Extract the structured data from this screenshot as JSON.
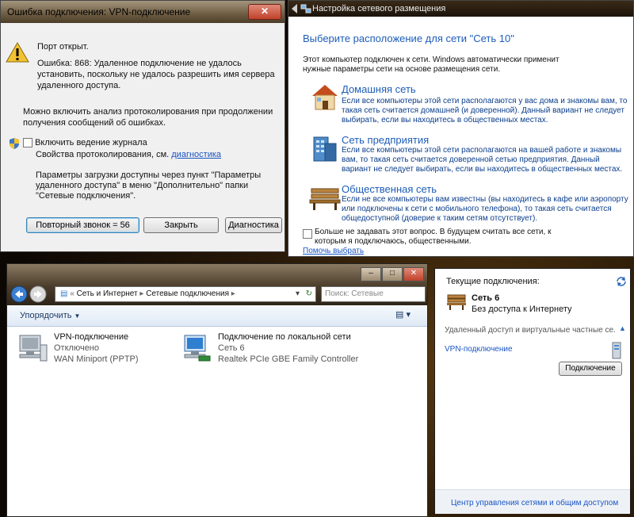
{
  "error_dialog": {
    "title": "Ошибка подключения: VPN-подключение",
    "port_text": "Порт открыт.",
    "error_text": "Ошибка: 868: Удаленное подключение не удалось установить, поскольку не удалось разрешить имя сервера удаленного доступа.",
    "logging_text": "Можно включить анализ протоколирования при продолжении получения сообщений об ошибках.",
    "enable_log_label": "Включить ведение журнала",
    "log_props_text": "Свойства протоколирования, см.",
    "diagnostics_link": "диагностика",
    "params_text": "Параметры загрузки доступны через пункт \"Параметры удаленного доступа\" в меню \"Дополнительно\" папки \"Сетевые подключения\".",
    "redial_button": "Повторный звонок = 56",
    "close_button": "Закрыть",
    "diagnose_button": "Диагностика"
  },
  "location_window": {
    "title": "Настройка сетевого размещения",
    "heading": "Выберите расположение для сети \"Сеть  10\"",
    "intro": "Этот компьютер подключен к сети. Windows автоматически применит нужные параметры сети на основе размещения сети.",
    "options": [
      {
        "title": "Домашняя сеть",
        "desc": "Если все компьютеры этой сети располагаются у вас дома и знакомы вам, то такая сеть считается домашней (и доверенной). Данный вариант не следует выбирать, если вы находитесь в общественных местах."
      },
      {
        "title": "Сеть предприятия",
        "desc": "Если все компьютеры этой сети располагаются на вашей работе и знакомы вам, то такая сеть считается доверенной сетью предприятия. Данный вариант не следует выбирать, если вы находитесь в общественных местах."
      },
      {
        "title": "Общественная сеть",
        "desc": "Если не все компьютеры вам известны (вы находитесь в кафе или аэропорту или подключены к сети с мобильного телефона), то такая сеть считается общедоступной (доверие к таким сетям отсутствует)."
      }
    ],
    "dont_ask_label": "Больше не задавать этот вопрос. В будущем считать все сети, к которым я подключаюсь, общественными.",
    "help_link": "Помочь выбрать"
  },
  "explorer": {
    "breadcrumb": [
      "Сеть и Интернет",
      "Сетевые подключения"
    ],
    "search_placeholder": "Поиск: Сетевые подключения",
    "organize_label": "Упорядочить",
    "connections": [
      {
        "name": "VPN-подключение",
        "status": "Отключено",
        "device": "WAN Miniport (PPTP)"
      },
      {
        "name": "Подключение по локальной сети",
        "status": "Сеть  6",
        "device": "Realtek PCIe GBE Family Controller"
      }
    ]
  },
  "flyout": {
    "current_label": "Текущие подключения:",
    "network_name": "Сеть  6",
    "network_status": "Без доступа к Интернету",
    "section_label": "Удаленный доступ и виртуальные частные се...",
    "vpn_name": "VPN-подключение",
    "connect_button": "Подключение",
    "footer_link": "Центр управления сетями и общим доступом"
  }
}
